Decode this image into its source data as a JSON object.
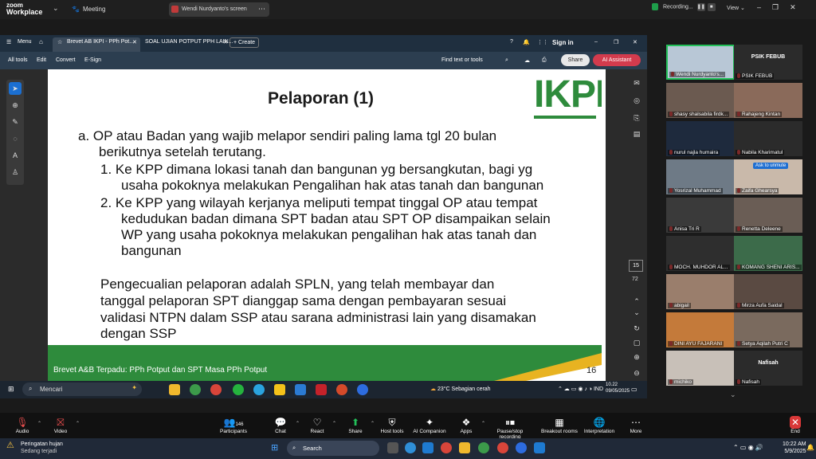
{
  "zoom": {
    "logo_line1": "zoom",
    "logo_line2": "Workplace",
    "meeting_label": "Meeting",
    "share_banner": "Wendi Nurdyanto's screen",
    "recording": "Recording...",
    "view": "View"
  },
  "acrobat": {
    "menu": "Menu",
    "tab1": "Brevet AB IKPI - PPh Pot...",
    "tab2": "SOAL UJIAN POTPUT PPH LAIN...",
    "create": "Create",
    "sign_in": "Sign in",
    "tools": [
      "All tools",
      "Edit",
      "Convert",
      "E-Sign"
    ],
    "find": "Find text or tools",
    "share": "Share",
    "ai": "AI Assistant",
    "page_current": "15",
    "page_total": "72"
  },
  "slide": {
    "title": "Pelaporan (1)",
    "logo": "IKPI",
    "lines": [
      "a.  OP atau Badan yang wajib melapor sendiri paling lama tgl 20 bulan",
      "berikutnya setelah terutang.",
      "1.  Ke KPP dimana lokasi tanah dan bangunan yg bersangkutan, bagi yg",
      "usaha  pokoknya melakukan Pengalihan hak atas tanah dan bangunan",
      "2.  Ke KPP yang wilayah kerjanya meliputi tempat tinggal OP atau tempat",
      "kedudukan  badan dimana SPT badan atau SPT OP disampaikan selain",
      "WP yang usaha  pokoknya melakukan pengalihan hak atas tanah dan",
      "bangunan",
      "Pengecualian pelaporan adalah SPLN, yang telah membayar dan",
      "tanggal  pelaporan SPT dianggap sama dengan pembayaran sesuai",
      "validasi NTPN dalam SSP atau  sarana administrasi lain yang disamakan",
      "dengan SSP"
    ],
    "footer": "Brevet A&B Terpadu: PPh Potput dan SPT Masa PPh Potput",
    "number": "16"
  },
  "shared_taskbar": {
    "search": "Mencari",
    "weather": "23°C  Sebagian cerah",
    "lang": "IND",
    "time": "10.22",
    "date": "09/05/2025"
  },
  "gallery": {
    "tiles": [
      {
        "name": "Wendi Nurdyanto's..."
      },
      {
        "name": "PSIK FEBUB",
        "big": "PSIK FEBUB"
      },
      {
        "name": "shasy shalsabila firdk..."
      },
      {
        "name": "Rahajeng Kintan"
      },
      {
        "name": "nurul najla humaira"
      },
      {
        "name": "Nabila Kharimatul"
      },
      {
        "name": "Yosrizal Muhammad"
      },
      {
        "name": "Zaifa Ghearsya",
        "tag": "Ask to unmute"
      },
      {
        "name": "Anisa Tri R"
      },
      {
        "name": "Renetta Deleene"
      },
      {
        "name": "MOCH. MUHDOR AL..."
      },
      {
        "name": "KOMANG SHENI ARIS..."
      },
      {
        "name": "abigail"
      },
      {
        "name": "Mirza Aufa Saidal"
      },
      {
        "name": "DINI AYU FAJARANI"
      },
      {
        "name": "Setya Aqilah Putri C"
      },
      {
        "name": "michiko"
      },
      {
        "name": "Nafisah",
        "big": "Nafisah"
      }
    ]
  },
  "toolbar": {
    "audio": "Audio",
    "video": "Video",
    "participants": "Participants",
    "participants_count": "146",
    "chat": "Chat",
    "react": "React",
    "share": "Share",
    "host_tools": "Host tools",
    "ai_companion": "AI Companion",
    "apps": "Apps",
    "pause_recording": "Pause/stop recording",
    "breakout": "Breakout rooms",
    "interpretation": "Interpretation",
    "more": "More",
    "end": "End"
  },
  "host_taskbar": {
    "notif_title": "Peringatan hujan",
    "notif_sub": "Sedang terjadi",
    "search": "Search",
    "time": "10:22 AM",
    "date": "5/9/2025"
  }
}
